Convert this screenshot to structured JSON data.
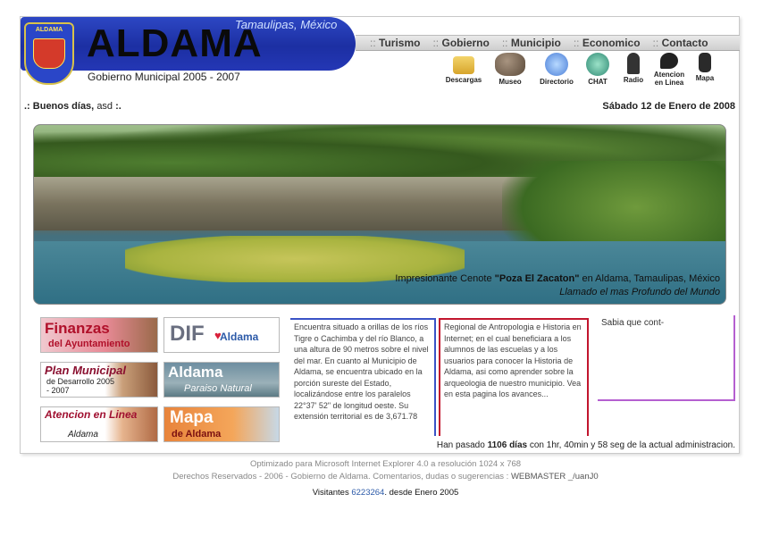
{
  "header": {
    "state": "Tamaulipas, México",
    "title": "ALDAMA",
    "subtitle": "Gobierno Municipal 2005 - 2007",
    "seal_text": "ALDAMA"
  },
  "nav": [
    "Turismo",
    "Gobierno",
    "Municipio",
    "Economico",
    "Contacto"
  ],
  "icons": [
    {
      "label": "Descargas",
      "icon": "folder-icon"
    },
    {
      "label": "Museo",
      "icon": "stone-icon"
    },
    {
      "label": "Directorio",
      "icon": "phone-icon"
    },
    {
      "label": "CHAT",
      "icon": "chat-icon"
    },
    {
      "label": "Radio",
      "icon": "guitar-icon"
    },
    {
      "label": "Atencion en Linea",
      "icon": "speech-icon"
    },
    {
      "label": "Mapa",
      "icon": "map-icon"
    }
  ],
  "greeting": {
    "prefix": ".: Buenos días,",
    "user": "asd",
    "suffix": ":."
  },
  "date": "Sábado 12 de Enero de 2008",
  "hero": {
    "caption_prefix": "Impresionante Cenote",
    "caption_bold": "\"Poza El Zacaton\"",
    "caption_suffix": "en Aldama, Tamaulipas, México",
    "caption2": "Llamado el mas Profundo del Mundo"
  },
  "banners": {
    "finanzas": {
      "l1": "Finanzas",
      "l2": "del Ayuntamiento"
    },
    "dif": {
      "l1": "DIF",
      "l2": "Aldama"
    },
    "plan": {
      "l1": "Plan Municipal",
      "l2": "de Desarrollo 2005 - 2007"
    },
    "aldama": {
      "l1": "Aldama",
      "l2": "Paraiso Natural"
    },
    "atencion": {
      "l1": "Atencion en Linea",
      "l2": "Aldama"
    },
    "mapa": {
      "l1": "Mapa",
      "l2": "de Aldama"
    }
  },
  "columns": {
    "col1": "Encuentra situado a orillas de los ríos Tigre o Cachimba y del río Blanco, a una altura de 90 metros sobre el nivel del mar. En cuanto al Municipio de Aldama, se encuentra ubicado en la porción sureste del Estado, localizándose entre los paralelos 22°37' 52\" de longitud oeste. Su extensión territorial es de 3,671.78",
    "col2": "Regional de Antropologia e Historia en Internet; en el cual beneficiara a los alumnos de las escuelas y a los usuarios para conocer la Historia de Aldama, asi como aprender sobre la arqueologia de nuestro municipio. Vea en esta pagina los avances...",
    "col3": "Sabia que cont-"
  },
  "elapsed": {
    "prefix": "Han pasado",
    "days": "1106 días",
    "suffix": "con 1hr, 40min y 58 seg de la actual administracion."
  },
  "footer": {
    "line1": "Optimizado para Microsoft Internet Explorer 4.0 a resolución 1024 x 768",
    "line2": "Derechos Reservados - 2006 - Gobierno de Aldama. Comentarios, dudas o sugerencias :",
    "webmaster": "WEBMASTER _/uanJ0",
    "visits_label": "Visitantes",
    "visits_count": "6223264",
    "visits_suffix": ". desde Enero 2005"
  }
}
